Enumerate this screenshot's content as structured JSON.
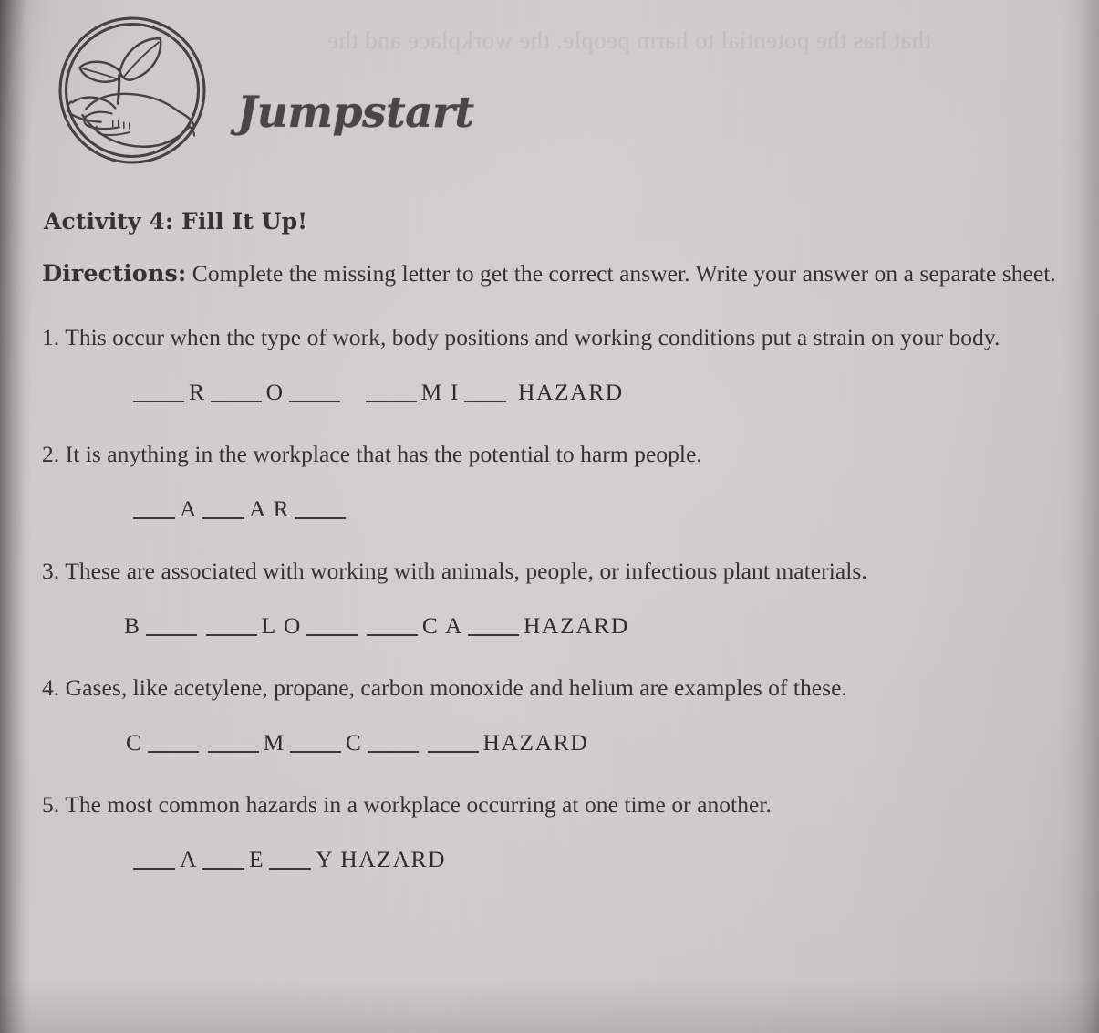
{
  "document": {
    "brand": "Jumpstart",
    "logo_icon": "hand-holding-sprout-icon",
    "activity_title": "Activity 4: Fill It Up!",
    "directions_label": "Directions:",
    "directions_text": "Complete the missing letter to get the correct answer. Write your answer on a separate sheet.",
    "showthrough_text": "that has the potential to harm people. the workplace and the"
  },
  "questions": [
    {
      "number": "1.",
      "prompt": "This occur when the type of work, body positions and working conditions put a strain on your body.",
      "answer_pattern": "___ R ___ O ___ ___ M I ___ HAZARD",
      "visible_letters": [
        "R",
        "O",
        "M I",
        "HAZARD"
      ],
      "blank_count": 5
    },
    {
      "number": "2.",
      "prompt": "It is anything in the workplace that has the potential to harm people.",
      "answer_pattern": "___ A ___ A R ____",
      "visible_letters": [
        "A",
        "A R"
      ],
      "blank_count": 3
    },
    {
      "number": "3.",
      "prompt": "These are associated with working with animals, people, or infectious plant materials.",
      "answer_pattern": "B ___ ___ L O ___ ___ C A ___ HAZARD",
      "visible_letters": [
        "B",
        "L O",
        "C A",
        "HAZARD"
      ],
      "blank_count": 5
    },
    {
      "number": "4.",
      "prompt": "Gases, like acetylene, propane, carbon monoxide and helium are examples of these.",
      "answer_pattern": "C ___ ___ M ___ C ___ ___ HAZARD",
      "visible_letters": [
        "C",
        "M",
        "C",
        "HAZARD"
      ],
      "blank_count": 5
    },
    {
      "number": "5.",
      "prompt": "The most common hazards in a workplace occurring at one time or another.",
      "answer_pattern": "___ A ___ E ___ Y HAZARD",
      "visible_letters": [
        "A",
        "E",
        "Y HAZARD"
      ],
      "blank_count": 3
    }
  ],
  "answer_lines": {
    "q1": {
      "l1": "R",
      "l2": "O",
      "l3": "M I",
      "l4": "HAZARD"
    },
    "q2": {
      "l1": "A",
      "l2": "A R"
    },
    "q3": {
      "l1": "B",
      "l2": "L O",
      "l3": "C A",
      "l4": "HAZARD"
    },
    "q4": {
      "l1": "C",
      "l2": "M",
      "l3": "C",
      "l4": "HAZARD"
    },
    "q5": {
      "l1": "A",
      "l2": "E",
      "l3": "Y HAZARD"
    }
  },
  "colors": {
    "paper": "#cdcaca",
    "ink": "#35332f",
    "rule": "#3a3836"
  }
}
